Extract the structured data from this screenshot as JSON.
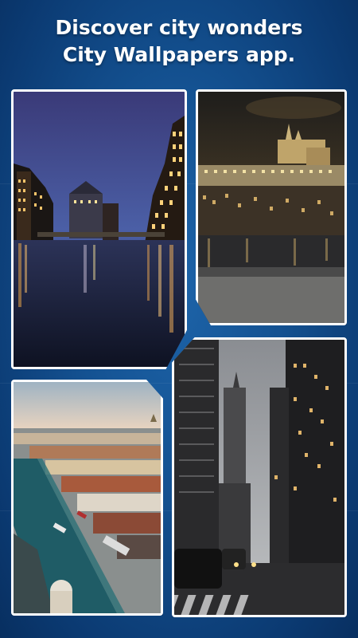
{
  "headline": {
    "line1": "Discover city wonders",
    "line2": "City Wallpapers app."
  },
  "gallery": {
    "tiles": [
      {
        "scene": "night canal with lit warehouses",
        "icon": "hamburg-canal-image"
      },
      {
        "scene": "castle on hill at night over river",
        "icon": "prague-castle-image"
      },
      {
        "scene": "aerial view of harbor city at dawn",
        "icon": "copenhagen-harbor-image"
      },
      {
        "scene": "skyscrapers street with traffic at dusk",
        "icon": "newyork-street-image"
      }
    ]
  },
  "colors": {
    "background": "#145292",
    "headline_text": "#ffffff",
    "tile_border": "#ffffff"
  }
}
